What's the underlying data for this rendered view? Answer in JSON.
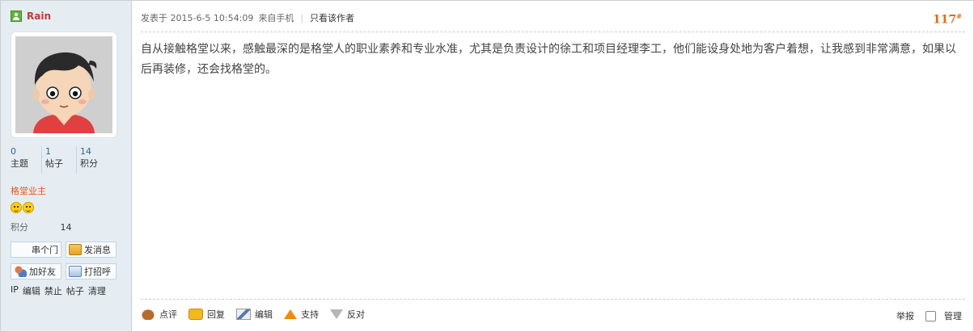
{
  "sidebar": {
    "author_name": "Rain",
    "stats": [
      {
        "value": "0",
        "label": "主题"
      },
      {
        "value": "1",
        "label": "帖子"
      },
      {
        "value": "14",
        "label": "积分"
      }
    ],
    "group": "格堂业主",
    "credits_label": "积分",
    "credits_value": "14",
    "buttons": {
      "visit": "串个门",
      "message": "发消息",
      "add_friend": "加好友",
      "poke": "打招呼"
    },
    "admin_links": [
      "IP",
      "编辑",
      "禁止",
      "帖子",
      "清理"
    ]
  },
  "post": {
    "posted_on": "发表于 2015-6-5 10:54:09",
    "source": "来自手机",
    "author_only": "只看该作者",
    "floor_number": "117",
    "floor_suffix": "#",
    "content": "自从接触格堂以来，感触最深的是格堂人的职业素养和专业水准，尤其是负责设计的徐工和项目经理李工，他们能设身处地为客户着想，让我感到非常满意，如果以后再装修，还会找格堂的。"
  },
  "actions": {
    "rate": "点评",
    "reply": "回复",
    "edit": "编辑",
    "support": "支持",
    "oppose": "反对",
    "report": "举报",
    "manage": "管理"
  },
  "colors": {
    "sidebar_bg": "#e5edf2",
    "author_name": "#c23a3a",
    "group_name": "#ee5023",
    "floor_number": "#e26c0e",
    "stat_value": "#336699"
  },
  "icons": [
    "online-user-icon",
    "smiley-icon",
    "message-icon",
    "add-friend-icon",
    "poke-icon",
    "rate-icon",
    "reply-icon",
    "edit-icon",
    "support-arrow-icon",
    "oppose-arrow-icon"
  ]
}
